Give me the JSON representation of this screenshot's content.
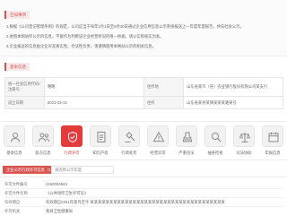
{
  "notice": {
    "tag": "告知事项",
    "lines": [
      "1.根据《公司登记管理条例》的规定，公司应当于每年1月1日至6月30日通过企业信用信息公示系统报送上一年度年度报告，并向社会公示。",
      "2.依照本网站所公示的信息，不能作为判断该企业经营状况的唯一依据，请以实际核实为准。",
      "3.企业报送的信息由企业对其真实性、合法性负责，请谨慎使用本网站公示的相关信息。"
    ]
  },
  "basic": {
    "tag": "基本信息",
    "rows": [
      [
        "统一社会信用代码/注册号",
        "略略",
        "住所地",
        "山东省某市（县）农业银行股份有限公司某支行"
      ],
      [
        "成立日期",
        "2021-02-21",
        "住所",
        "山东省某县某镇某某某路某号"
      ]
    ]
  },
  "tabs": [
    {
      "label": "基本信息",
      "icon": "profile-icon",
      "active": false
    },
    {
      "label": "股东信息",
      "icon": "people-icon",
      "active": false
    },
    {
      "label": "行政许可",
      "icon": "shield-icon",
      "active": true
    },
    {
      "label": "知识产权",
      "icon": "document-icon",
      "active": false
    },
    {
      "label": "行政处罚",
      "icon": "gavel-icon",
      "active": false
    },
    {
      "label": "经营异常",
      "icon": "warning-icon",
      "active": false
    },
    {
      "label": "严重违法",
      "icon": "stamp-icon",
      "active": false
    },
    {
      "label": "抽查检查",
      "icon": "search-icon",
      "active": false
    },
    {
      "label": "司法协助",
      "icon": "balance-icon",
      "active": false
    },
    {
      "label": "年报信息",
      "icon": "calendar-icon",
      "active": false
    }
  ],
  "detail": {
    "tab_label": "企业公示行政许可信息（1）",
    "select_value": "请选择公示年度",
    "rows": [
      [
        "许可文件编号",
        "2150094563"
      ],
      [
        "许可文件名称",
        "《公共场所卫生许可证》"
      ],
      [
        "有效期自",
        "有效期自2021年某月至今 某某某某某某某某某某某某某某某某某某某某某某某某某某某某某某某某某某某"
      ],
      [
        "许可机关",
        "某县卫生健康局"
      ]
    ]
  },
  "colors": {
    "accent": "#e33b3b",
    "tag_bg": "#f7e9e9"
  }
}
